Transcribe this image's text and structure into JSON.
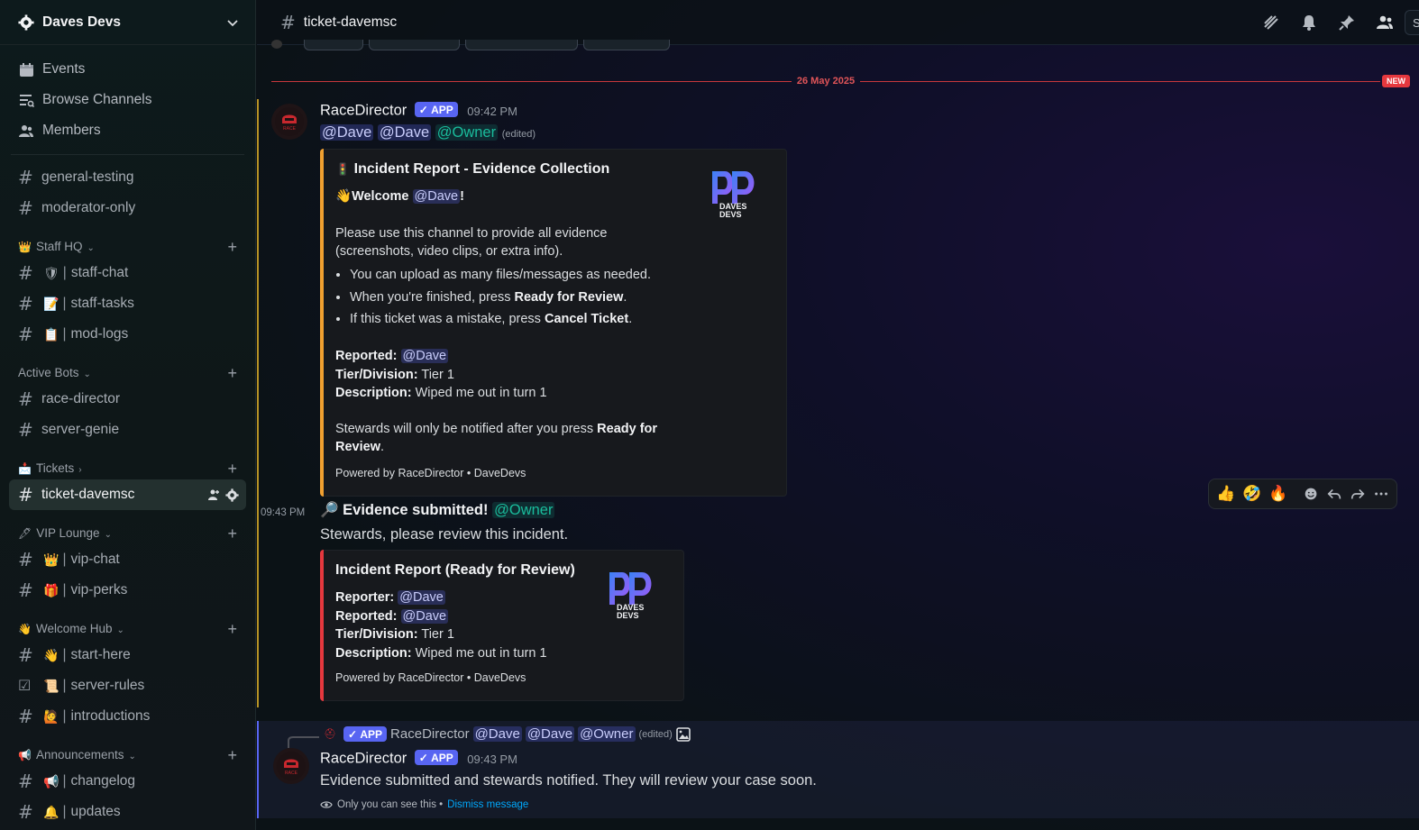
{
  "server": {
    "name": "Daves Devs"
  },
  "nav": [
    {
      "label": "Events",
      "icon": "calendar-icon"
    },
    {
      "label": "Browse Channels",
      "icon": "browse-channels-icon"
    },
    {
      "label": "Members",
      "icon": "members-icon"
    }
  ],
  "channels_top": [
    "general-testing",
    "moderator-only"
  ],
  "categories": {
    "staff_hq": {
      "name": "Staff HQ",
      "emoji": "👑",
      "channels": [
        {
          "emoji": "🛡",
          "name": "staff-chat"
        },
        {
          "emoji": "📝",
          "name": "staff-tasks"
        },
        {
          "emoji": "📋",
          "name": "mod-logs"
        }
      ]
    },
    "active_bots": {
      "name": "Active Bots",
      "channels": [
        "race-director",
        "server-genie"
      ]
    },
    "tickets": {
      "name": "Tickets",
      "emoji": "📩",
      "active_channel": "ticket-davemsc"
    },
    "vip_lounge": {
      "name": "VIP Lounge",
      "emoji": "🖋",
      "channels": [
        {
          "emoji": "👑",
          "name": "vip-chat"
        },
        {
          "emoji": "🎁",
          "name": "vip-perks"
        }
      ]
    },
    "welcome_hub": {
      "name": "Welcome Hub",
      "emoji": "👋",
      "channels": [
        {
          "emoji": "👋",
          "name": "start-here"
        },
        {
          "emoji": "📜",
          "name": "server-rules"
        },
        {
          "emoji": "🙋",
          "name": "introductions"
        }
      ]
    },
    "announcements": {
      "name": "Announcements",
      "emoji": "📢",
      "channels": [
        {
          "emoji": "📢",
          "name": "changelog"
        },
        {
          "emoji": "🔔",
          "name": "updates"
        }
      ]
    }
  },
  "header": {
    "channel": "ticket-davemsc",
    "search_stub": "Se"
  },
  "date_separator": {
    "date": "26 May 2025",
    "new_label": "NEW"
  },
  "msg1": {
    "author": "RaceDirector",
    "app_label": "APP",
    "time": "09:42 PM",
    "mentions": [
      "@Dave",
      "@Dave",
      "@Owner"
    ],
    "edited": "(edited)",
    "embed": {
      "title_emoji": "🚦",
      "title": "Incident Report - Evidence Collection",
      "welcome_emoji": "👋",
      "welcome": "Welcome",
      "welcome_mention": "@Dave",
      "welcome_end": "!",
      "intro": "Please use this channel to provide all evidence (screenshots, video clips, or extra info).",
      "bullets": [
        {
          "text": "You can upload as many files/messages as needed.",
          "bold": "",
          "end": ""
        },
        {
          "text": "When you're finished, press ",
          "bold": "Ready for Review",
          "end": "."
        },
        {
          "text": "If this ticket was a mistake, press ",
          "bold": "Cancel Ticket",
          "end": "."
        }
      ],
      "reported_label": "Reported:",
      "reported": "@Dave",
      "tier_label": "Tier/Division:",
      "tier": "Tier 1",
      "desc_label": "Description:",
      "desc": "Wiped me out in turn 1",
      "notify_text": "Stewards will only be notified after you press ",
      "notify_bold": "Ready for Review",
      "notify_end": ".",
      "footer": "Powered by RaceDirector • DaveDevs",
      "logo_text_1": "DAVES",
      "logo_text_2": "DEVS",
      "stripe_color": "#f0a030"
    }
  },
  "msg2": {
    "time": "09:43 PM",
    "emoji": "🔎",
    "title": "Evidence submitted!",
    "mention": "@Owner",
    "text": "Stewards, please review this incident.",
    "embed": {
      "title": "Incident Report (Ready for Review)",
      "reporter_label": "Reporter:",
      "reporter": "@Dave",
      "reported_label": "Reported:",
      "reported": "@Dave",
      "tier_label": "Tier/Division:",
      "tier": "Tier 1",
      "desc_label": "Description:",
      "desc": "Wiped me out in turn 1",
      "footer": "Powered by RaceDirector • DaveDevs",
      "logo_text_1": "DAVES",
      "logo_text_2": "DEVS",
      "stripe_color": "#e5383e"
    }
  },
  "hover_actions": {
    "reactions": [
      "👍",
      "🤣",
      "🔥"
    ]
  },
  "msg3": {
    "reply_app_label": "APP",
    "reply_author": "RaceDirector",
    "reply_mentions": [
      "@Dave",
      "@Dave",
      "@Owner"
    ],
    "reply_edited": "(edited)",
    "author": "RaceDirector",
    "app_label": "APP",
    "time": "09:43 PM",
    "text": "Evidence submitted and stewards notified. They will review your case soon.",
    "only_you": "Only you can see this •",
    "dismiss": "Dismiss message"
  },
  "colors": {
    "accent": "#5865f2",
    "role_mention": "#1abc9c",
    "new_marker": "#e5383e"
  }
}
